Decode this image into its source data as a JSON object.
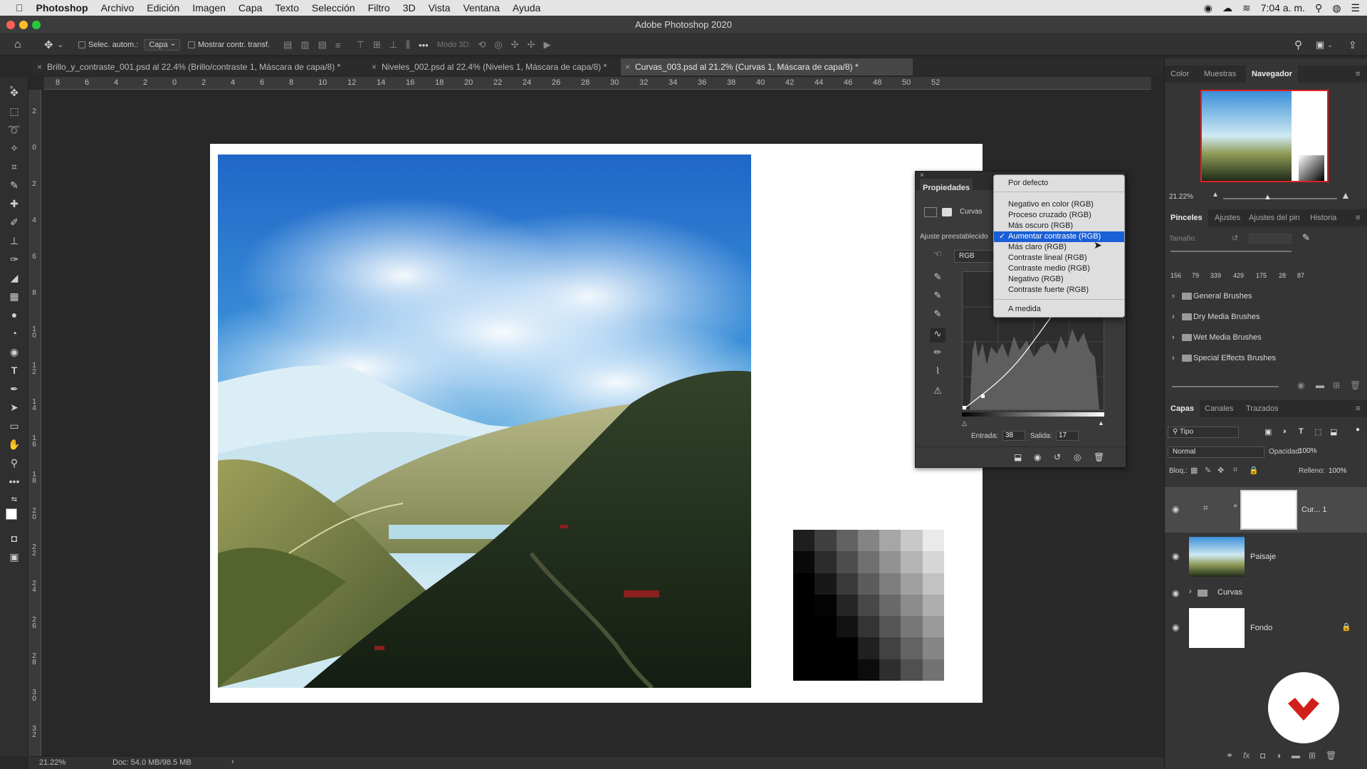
{
  "menubar": {
    "app": "Photoshop",
    "items": [
      "Archivo",
      "Edición",
      "Imagen",
      "Capa",
      "Texto",
      "Selección",
      "Filtro",
      "3D",
      "Vista",
      "Ventana",
      "Ayuda"
    ],
    "time": "7:04 a. m."
  },
  "window": {
    "title": "Adobe Photoshop 2020"
  },
  "options": {
    "auto_select_label": "Selec. autom.:",
    "auto_select_value": "Capa",
    "show_transform_label": "Mostrar contr. transf.",
    "mode3d_label": "Modo 3D:"
  },
  "tabs": [
    {
      "label": "Brillo_y_contraste_001.psd al 22.4% (Brillo/contraste 1, Máscara de capa/8) *",
      "active": false
    },
    {
      "label": "Niveles_002.psd al 22.4% (Niveles 1, Máscara de capa/8) *",
      "active": false
    },
    {
      "label": "Curvas_003.psd al 21.2% (Curvas 1, Máscara de capa/8) *",
      "active": true
    }
  ],
  "ruler_top": [
    "8",
    "6",
    "4",
    "2",
    "0",
    "2",
    "4",
    "6",
    "8",
    "10",
    "12",
    "14",
    "16",
    "18",
    "20",
    "22",
    "24",
    "26",
    "28",
    "30",
    "32",
    "34",
    "36",
    "38",
    "40",
    "42",
    "44",
    "46",
    "48",
    "50",
    "52"
  ],
  "ruler_left": [
    "2",
    "0",
    "2",
    "4",
    "6",
    "8",
    "1 0",
    "1 2",
    "1 4",
    "1 6",
    "1 8",
    "2 0",
    "2 2",
    "2 4",
    "2 6",
    "2 8",
    "3 0",
    "3 2"
  ],
  "status": {
    "zoom": "21.22%",
    "doc": "Doc: 54.0 MB/98.5 MB"
  },
  "properties": {
    "title": "Propiedades",
    "adjustment": "Curvas",
    "preset_label": "Ajuste preestablecido",
    "channel": "RGB",
    "input_label": "Entrada:",
    "input_value": "38",
    "output_label": "Salida:",
    "output_value": "17"
  },
  "preset_menu": {
    "items": [
      "Por defecto",
      "Negativo en color (RGB)",
      "Proceso cruzado (RGB)",
      "Más oscuro (RGB)",
      "Aumentar contraste (RGB)",
      "Más claro (RGB)",
      "Contraste lineal (RGB)",
      "Contraste medio (RGB)",
      "Negativo (RGB)",
      "Contraste fuerte (RGB)",
      "A medida"
    ],
    "selected": "Aumentar contraste (RGB)"
  },
  "navigator": {
    "tabs": [
      "Color",
      "Muestras",
      "Navegador"
    ],
    "active": "Navegador",
    "zoom": "21.22%"
  },
  "brushes": {
    "tabs": [
      "Pinceles",
      "Ajustes",
      "Ajustes del pin",
      "Historia"
    ],
    "size_label": "Tamaño:",
    "presets": [
      "156",
      "79",
      "339",
      "429",
      "175",
      "28",
      "87"
    ],
    "folders": [
      "General Brushes",
      "Dry Media Brushes",
      "Wet Media Brushes",
      "Special Effects Brushes"
    ]
  },
  "layers": {
    "tabs": [
      "Capas",
      "Canales",
      "Trazados"
    ],
    "filter": "Tipo",
    "blend_mode": "Normal",
    "opacity_label": "Opacidad:",
    "opacity": "100%",
    "lock_label": "Bloq.:",
    "fill_label": "Relleno:",
    "fill": "100%",
    "items": [
      {
        "name": "Cur... 1"
      },
      {
        "name": "Paisaje"
      },
      {
        "name": "Curvas"
      },
      {
        "name": "Fondo"
      }
    ]
  },
  "colors": {
    "accent": "#1a5fd6",
    "logo": "#d1201b"
  }
}
